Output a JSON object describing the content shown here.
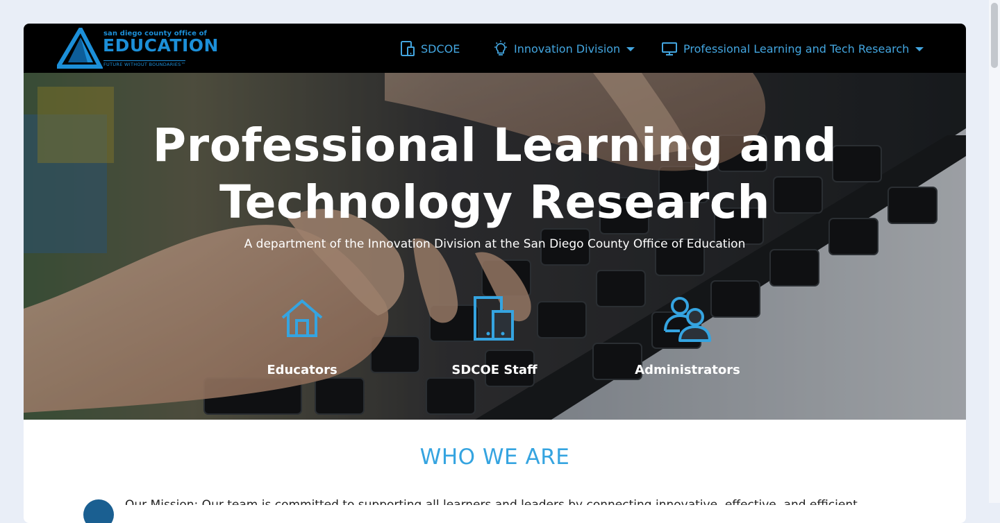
{
  "logo": {
    "top_text": "san diego county office of",
    "main_text": "EDUCATION",
    "tagline": "FUTURE WITHOUT BOUNDARIES™"
  },
  "nav": {
    "items": [
      {
        "label": "SDCOE",
        "icon": "tablet-phone-icon",
        "has_dropdown": false
      },
      {
        "label": "Innovation Division",
        "icon": "lightbulb-icon",
        "has_dropdown": true
      },
      {
        "label": "Professional Learning and Tech Research",
        "icon": "monitor-icon",
        "has_dropdown": true
      }
    ]
  },
  "hero": {
    "title_line1": "Professional Learning and",
    "title_line2": "Technology Research",
    "subtitle": "A department of the Innovation Division at the San Diego County Office of Education",
    "audiences": [
      {
        "label": "Educators",
        "icon": "house-icon"
      },
      {
        "label": "SDCOE Staff",
        "icon": "devices-icon"
      },
      {
        "label": "Administrators",
        "icon": "users-icon"
      }
    ]
  },
  "who": {
    "heading": "WHO WE ARE",
    "intro_preview": "Our Mission: Our team is committed to supporting all learners and leaders by connecting innovative, effective, and efficient"
  },
  "colors": {
    "accent": "#35a4e0",
    "nav_bg": "#000000",
    "page_bg": "#e9eef7"
  }
}
